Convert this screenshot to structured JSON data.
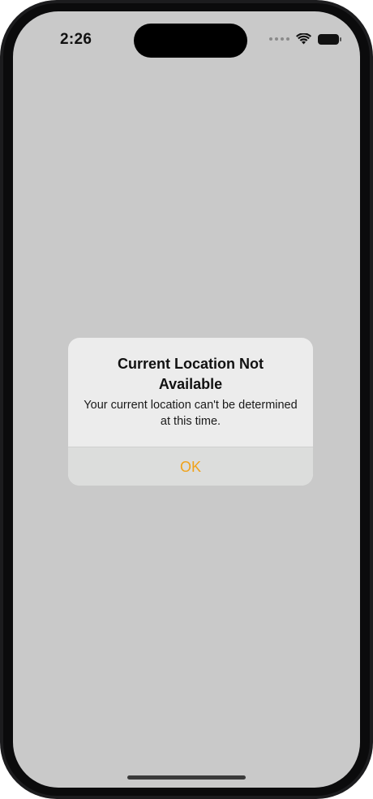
{
  "status_bar": {
    "time": "2:26"
  },
  "alert": {
    "title": "Current Location Not Available",
    "message": "Your current location can't be determined at this time.",
    "ok_label": "OK"
  },
  "colors": {
    "accent": "#f0a21a",
    "backdrop": "#c9c9c9"
  }
}
